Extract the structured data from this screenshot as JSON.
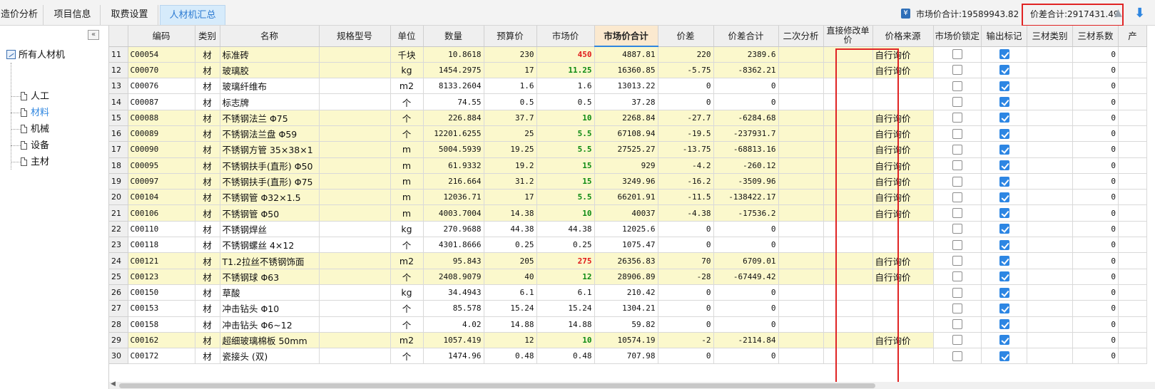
{
  "tabs": [
    {
      "label": "造价分析",
      "active": false
    },
    {
      "label": "项目信息",
      "active": false
    },
    {
      "label": "取费设置",
      "active": false
    },
    {
      "label": "人材机汇总",
      "active": true
    }
  ],
  "summary": {
    "market_total": "市场价合计:19589943.82",
    "diff_total": "价差合计:2917431.49"
  },
  "tree": {
    "collapse": "«",
    "root": "所有人材机",
    "items": [
      "人工",
      "材料",
      "机械",
      "设备",
      "主材"
    ],
    "selected": "材料"
  },
  "columns": [
    "",
    "编码",
    "类别",
    "名称",
    "规格型号",
    "单位",
    "数量",
    "预算价",
    "市场价",
    "市场价合计",
    "价差",
    "价差合计",
    "二次分析",
    "直接修改单价",
    "价格来源",
    "市场价锁定",
    "输出标记",
    "三材类别",
    "三材系数",
    "产"
  ],
  "sorted_column": "市场价合计",
  "rows": [
    {
      "n": "11",
      "code": "C00054",
      "type": "材",
      "name": "标准砖",
      "spec": "",
      "unit": "千块",
      "qty": "10.8618",
      "budget": "230",
      "market": "450",
      "mcolor": "red",
      "mtotal": "4887.81",
      "diff": "220",
      "difftotal": "2389.6",
      "src": "自行询价",
      "locked": false,
      "out": true,
      "coef": "0",
      "hl": true
    },
    {
      "n": "12",
      "code": "C00070",
      "type": "材",
      "name": "玻璃胶",
      "spec": "",
      "unit": "kg",
      "qty": "1454.2975",
      "budget": "17",
      "market": "11.25",
      "mcolor": "green",
      "mtotal": "16360.85",
      "diff": "-5.75",
      "difftotal": "-8362.21",
      "src": "自行询价",
      "locked": false,
      "out": true,
      "coef": "0",
      "hl": true
    },
    {
      "n": "13",
      "code": "C00076",
      "type": "材",
      "name": "玻璃纤维布",
      "spec": "",
      "unit": "m2",
      "qty": "8133.2604",
      "budget": "1.6",
      "market": "1.6",
      "mcolor": "",
      "mtotal": "13013.22",
      "diff": "0",
      "difftotal": "0",
      "src": "",
      "locked": false,
      "out": true,
      "coef": "0",
      "hl": false
    },
    {
      "n": "14",
      "code": "C00087",
      "type": "材",
      "name": "标志牌",
      "spec": "",
      "unit": "个",
      "qty": "74.55",
      "budget": "0.5",
      "market": "0.5",
      "mcolor": "",
      "mtotal": "37.28",
      "diff": "0",
      "difftotal": "0",
      "src": "",
      "locked": false,
      "out": true,
      "coef": "0",
      "hl": false
    },
    {
      "n": "15",
      "code": "C00088",
      "type": "材",
      "name": "不锈钢法兰 Φ75",
      "spec": "",
      "unit": "个",
      "qty": "226.884",
      "budget": "37.7",
      "market": "10",
      "mcolor": "green",
      "mtotal": "2268.84",
      "diff": "-27.7",
      "difftotal": "-6284.68",
      "src": "自行询价",
      "locked": false,
      "out": true,
      "coef": "0",
      "hl": true
    },
    {
      "n": "16",
      "code": "C00089",
      "type": "材",
      "name": "不锈钢法兰盘 Φ59",
      "spec": "",
      "unit": "个",
      "qty": "12201.6255",
      "budget": "25",
      "market": "5.5",
      "mcolor": "green",
      "mtotal": "67108.94",
      "diff": "-19.5",
      "difftotal": "-237931.7",
      "src": "自行询价",
      "locked": false,
      "out": true,
      "coef": "0",
      "hl": true
    },
    {
      "n": "17",
      "code": "C00090",
      "type": "材",
      "name": "不锈钢方管 35×38×1",
      "spec": "",
      "unit": "m",
      "qty": "5004.5939",
      "budget": "19.25",
      "market": "5.5",
      "mcolor": "green",
      "mtotal": "27525.27",
      "diff": "-13.75",
      "difftotal": "-68813.16",
      "src": "自行询价",
      "locked": false,
      "out": true,
      "coef": "0",
      "hl": true
    },
    {
      "n": "18",
      "code": "C00095",
      "type": "材",
      "name": "不锈钢扶手(直形) Φ50",
      "spec": "",
      "unit": "m",
      "qty": "61.9332",
      "budget": "19.2",
      "market": "15",
      "mcolor": "green",
      "mtotal": "929",
      "diff": "-4.2",
      "difftotal": "-260.12",
      "src": "自行询价",
      "locked": false,
      "out": true,
      "coef": "0",
      "hl": true
    },
    {
      "n": "19",
      "code": "C00097",
      "type": "材",
      "name": "不锈钢扶手(直形) Φ75",
      "spec": "",
      "unit": "m",
      "qty": "216.664",
      "budget": "31.2",
      "market": "15",
      "mcolor": "green",
      "mtotal": "3249.96",
      "diff": "-16.2",
      "difftotal": "-3509.96",
      "src": "自行询价",
      "locked": false,
      "out": true,
      "coef": "0",
      "hl": true
    },
    {
      "n": "20",
      "code": "C00104",
      "type": "材",
      "name": "不锈钢管 Φ32×1.5",
      "spec": "",
      "unit": "m",
      "qty": "12036.71",
      "budget": "17",
      "market": "5.5",
      "mcolor": "green",
      "mtotal": "66201.91",
      "diff": "-11.5",
      "difftotal": "-138422.17",
      "src": "自行询价",
      "locked": false,
      "out": true,
      "coef": "0",
      "hl": true
    },
    {
      "n": "21",
      "code": "C00106",
      "type": "材",
      "name": "不锈钢管 Φ50",
      "spec": "",
      "unit": "m",
      "qty": "4003.7004",
      "budget": "14.38",
      "market": "10",
      "mcolor": "green",
      "mtotal": "40037",
      "diff": "-4.38",
      "difftotal": "-17536.2",
      "src": "自行询价",
      "locked": false,
      "out": true,
      "coef": "0",
      "hl": true
    },
    {
      "n": "22",
      "code": "C00110",
      "type": "材",
      "name": "不锈钢焊丝",
      "spec": "",
      "unit": "kg",
      "qty": "270.9688",
      "budget": "44.38",
      "market": "44.38",
      "mcolor": "",
      "mtotal": "12025.6",
      "diff": "0",
      "difftotal": "0",
      "src": "",
      "locked": false,
      "out": true,
      "coef": "0",
      "hl": false
    },
    {
      "n": "23",
      "code": "C00118",
      "type": "材",
      "name": "不锈钢螺丝 4×12",
      "spec": "",
      "unit": "个",
      "qty": "4301.8666",
      "budget": "0.25",
      "market": "0.25",
      "mcolor": "",
      "mtotal": "1075.47",
      "diff": "0",
      "difftotal": "0",
      "src": "",
      "locked": false,
      "out": true,
      "coef": "0",
      "hl": false
    },
    {
      "n": "24",
      "code": "C00121",
      "type": "材",
      "name": "T1.2拉丝不锈钢饰面",
      "spec": "",
      "unit": "m2",
      "qty": "95.843",
      "budget": "205",
      "market": "275",
      "mcolor": "red",
      "mtotal": "26356.83",
      "diff": "70",
      "difftotal": "6709.01",
      "src": "自行询价",
      "locked": false,
      "out": true,
      "coef": "0",
      "hl": true
    },
    {
      "n": "25",
      "code": "C00123",
      "type": "材",
      "name": "不锈钢球 Φ63",
      "spec": "",
      "unit": "个",
      "qty": "2408.9079",
      "budget": "40",
      "market": "12",
      "mcolor": "green",
      "mtotal": "28906.89",
      "diff": "-28",
      "difftotal": "-67449.42",
      "src": "自行询价",
      "locked": false,
      "out": true,
      "coef": "0",
      "hl": true
    },
    {
      "n": "26",
      "code": "C00150",
      "type": "材",
      "name": "草酸",
      "spec": "",
      "unit": "kg",
      "qty": "34.4943",
      "budget": "6.1",
      "market": "6.1",
      "mcolor": "",
      "mtotal": "210.42",
      "diff": "0",
      "difftotal": "0",
      "src": "",
      "locked": false,
      "out": true,
      "coef": "0",
      "hl": false
    },
    {
      "n": "27",
      "code": "C00153",
      "type": "材",
      "name": "冲击钻头 Φ10",
      "spec": "",
      "unit": "个",
      "qty": "85.578",
      "budget": "15.24",
      "market": "15.24",
      "mcolor": "",
      "mtotal": "1304.21",
      "diff": "0",
      "difftotal": "0",
      "src": "",
      "locked": false,
      "out": true,
      "coef": "0",
      "hl": false
    },
    {
      "n": "28",
      "code": "C00158",
      "type": "材",
      "name": "冲击钻头 Φ6~12",
      "spec": "",
      "unit": "个",
      "qty": "4.02",
      "budget": "14.88",
      "market": "14.88",
      "mcolor": "",
      "mtotal": "59.82",
      "diff": "0",
      "difftotal": "0",
      "src": "",
      "locked": false,
      "out": true,
      "coef": "0",
      "hl": false
    },
    {
      "n": "29",
      "code": "C00162",
      "type": "材",
      "name": "超细玻璃棉板 50mm",
      "spec": "",
      "unit": "m2",
      "qty": "1057.419",
      "budget": "12",
      "market": "10",
      "mcolor": "green",
      "mtotal": "10574.19",
      "diff": "-2",
      "difftotal": "-2114.84",
      "src": "自行询价",
      "locked": false,
      "out": true,
      "coef": "0",
      "hl": true
    },
    {
      "n": "30",
      "code": "C00172",
      "type": "材",
      "name": "瓷接头 (双)",
      "spec": "",
      "unit": "个",
      "qty": "1474.96",
      "budget": "0.48",
      "market": "0.48",
      "mcolor": "",
      "mtotal": "707.98",
      "diff": "0",
      "difftotal": "0",
      "src": "",
      "locked": false,
      "out": true,
      "coef": "0",
      "hl": false
    }
  ]
}
